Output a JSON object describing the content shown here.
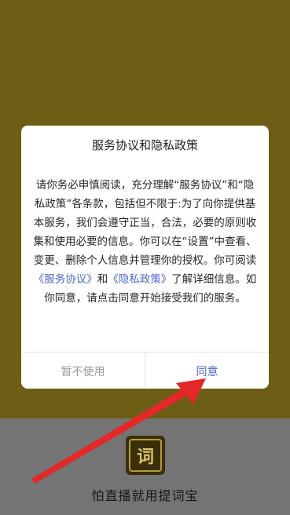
{
  "dialog": {
    "title": "服务协议和隐私政策",
    "body_prefix": "请你务必申慎阅读，充分理解“服务协议”和“隐私政策”各条款，包括但不限于:为了向你提供基本服务，我们会遵守正当，合法，必要的原则收集和使用必要的信息。你可以在“设置”中查看、变更、删除个人信息并管理你的授权。你可阅读",
    "link_service": "《服务协议》",
    "and_text": "和",
    "link_privacy": "《隐私政策》",
    "body_suffix": "了解详细信息。如你同意，请点击同意开始接受我们的服务。",
    "decline_label": "暂不使用",
    "agree_label": "同意"
  },
  "app": {
    "logo_char": "词",
    "tagline": "怕直播就用提词宝"
  },
  "colors": {
    "background_top": "#6e5d14",
    "background_bottom": "#747474",
    "link": "#4b67c9",
    "arrow": "#e3282a"
  }
}
